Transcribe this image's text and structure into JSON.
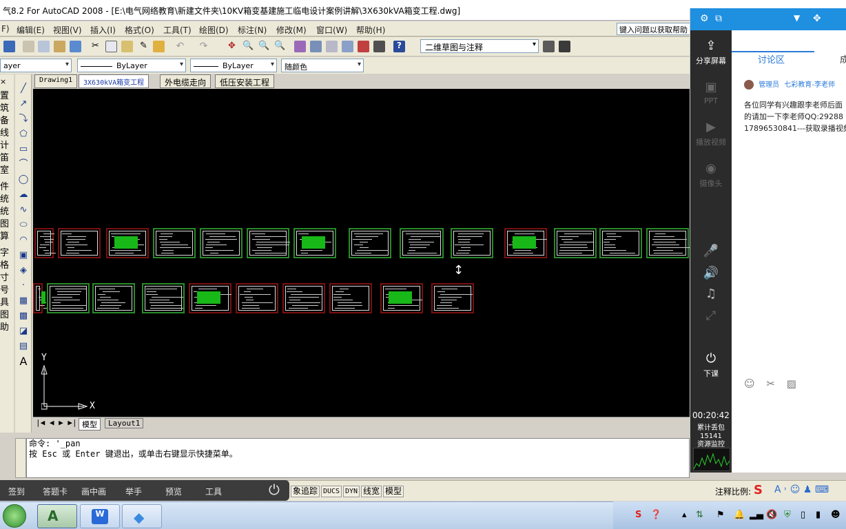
{
  "window": {
    "title": "气8.2 For AutoCAD 2008 - [E:\\电气网络教育\\新建文件夹\\10KV箱变基建施工临电设计案例讲解\\3X630kVA箱变工程.dwg]"
  },
  "menu": {
    "items": [
      "F)",
      "编辑(E)",
      "视图(V)",
      "插入(I)",
      "格式(O)",
      "工具(T)",
      "绘图(D)",
      "标注(N)",
      "修改(M)",
      "窗口(W)",
      "帮助(H)"
    ],
    "help_placeholder": "键入问题以获取帮助"
  },
  "toolbar": {
    "workspace": "二维草图与注释"
  },
  "properties": {
    "layer": "ayer",
    "linetype": "ByLayer",
    "lineweight": "ByLayer",
    "color": "随颜色"
  },
  "left_strip": [
    "置",
    "筑",
    "备",
    "线",
    "计",
    "笛",
    "室",
    "件",
    "统",
    "统",
    "图",
    "算",
    "字",
    "格",
    "寸",
    "号",
    "具",
    "图",
    "助"
  ],
  "file_tabs": [
    {
      "label": "Drawing1",
      "active": false
    },
    {
      "label": "3X630kVA箱变工程",
      "active": true
    },
    {
      "label": "外电缆走向",
      "active": false
    },
    {
      "label": "低压安装工程",
      "active": false
    }
  ],
  "ucs": {
    "y": "Y",
    "x": "X"
  },
  "layout_tabs": {
    "model": "模型",
    "layout": "Layout1"
  },
  "command": {
    "line1": "命令: '_pan",
    "line2": "按 Esc 或 Enter 键退出，或单击右键显示快捷菜单。"
  },
  "status": {
    "items": [
      "象追踪",
      "DUCS",
      "DYN",
      "线宽",
      "模型"
    ],
    "annotation_scale": "注释比例:"
  },
  "live_bar": {
    "items": [
      "签到",
      "答题卡",
      "画中画",
      "举手",
      "预览",
      "工具"
    ]
  },
  "panel": {
    "share_screen": "分享屏幕",
    "ppt": "PPT",
    "play_video": "播放视频",
    "camera": "摄像头",
    "end_class": "下课",
    "timer": "00:20:42",
    "packet_loss_label": "累计丢包",
    "packet_loss_value": "15141",
    "resource_monitor": "资源监控",
    "tab_discussion": "讨论区",
    "tab_other": "成",
    "sender_role": "管理员",
    "sender_name": "七彩教育-李老师",
    "message_line1": "各位同学有兴趣跟李老师后面",
    "message_line2": "的请加一下李老师QQ:29288",
    "message_line3": "17896530841---获取录播视频"
  },
  "colors": {
    "panel_header": "#1f8fe0",
    "panel_side": "#2b2b2b",
    "canvas": "#000000",
    "active_tab_text": "#1a3aa8"
  }
}
